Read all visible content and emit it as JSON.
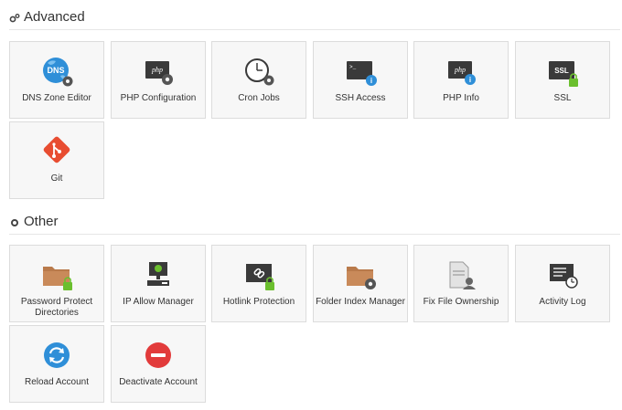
{
  "sections": {
    "advanced": {
      "title": "Advanced",
      "icon": "gears-icon",
      "tiles": [
        {
          "label": "DNS Zone Editor",
          "icon": "dns-icon"
        },
        {
          "label": "PHP Configuration",
          "icon": "php-config-icon"
        },
        {
          "label": "Cron Jobs",
          "icon": "clock-gear-icon"
        },
        {
          "label": "SSH Access",
          "icon": "terminal-info-icon"
        },
        {
          "label": "PHP Info",
          "icon": "php-info-icon"
        },
        {
          "label": "SSL",
          "icon": "ssl-lock-icon"
        },
        {
          "label": "Git",
          "icon": "git-icon"
        }
      ]
    },
    "other": {
      "title": "Other",
      "icon": "gear-icon",
      "tiles": [
        {
          "label": "Password Protect Directories",
          "icon": "folder-lock-icon"
        },
        {
          "label": "IP Allow Manager",
          "icon": "ip-allow-icon"
        },
        {
          "label": "Hotlink Protection",
          "icon": "hotlink-icon"
        },
        {
          "label": "Folder Index Manager",
          "icon": "folder-gear-icon"
        },
        {
          "label": "Fix File Ownership",
          "icon": "file-user-icon"
        },
        {
          "label": "Activity Log",
          "icon": "activity-log-icon"
        },
        {
          "label": "Reload Account",
          "icon": "reload-icon"
        },
        {
          "label": "Deactivate Account",
          "icon": "deactivate-icon"
        }
      ]
    }
  },
  "colors": {
    "blue": "#2f8fd8",
    "dark": "#3a3a3a",
    "gear": "#555555",
    "green": "#6bbf2e",
    "orange": "#b97a4b",
    "git_red": "#e84d31",
    "red": "#e23b3b"
  }
}
